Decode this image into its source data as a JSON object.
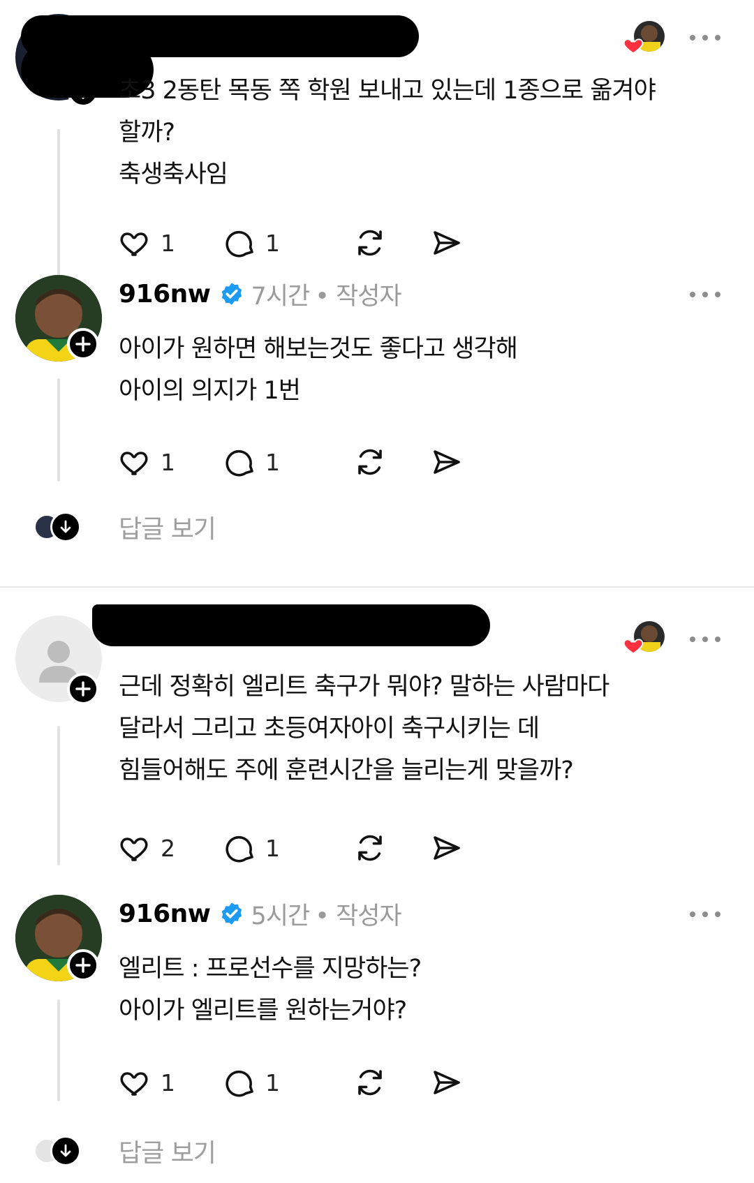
{
  "posts": [
    {
      "text": "초3 2동탄 목동 쪽 학원 보내고 있는데 1종으로 옮겨야\n할까?\n축생축사임",
      "likes": "1",
      "comments": "1"
    },
    {
      "username": "916nw",
      "time": "7시간",
      "author_tag": "• 작성자",
      "text": "아이가 원하면 해보는것도 좋다고 생각해\n아이의 의지가 1번",
      "likes": "1",
      "comments": "1"
    },
    {
      "text": "근데 정확히 엘리트 축구가 뭐야? 말하는 사람마다\n달라서 그리고 초등여자아이 축구시키는 데\n힘들어해도 주에 훈련시간을 늘리는게 맞을까?",
      "likes": "2",
      "comments": "1"
    },
    {
      "username": "916nw",
      "time": "5시간",
      "author_tag": "• 작성자",
      "text": "엘리트 : 프로선수를 지망하는?\n아이가 엘리트를 원하는거야?",
      "likes": "1",
      "comments": "1"
    }
  ],
  "view_replies_label": "답글 보기",
  "colors": {
    "verified_blue": "#1d9bf0",
    "heart_red": "#ff3040",
    "muted_text": "#9a9a9a"
  },
  "icons": [
    "heart-icon",
    "comment-icon",
    "repost-icon",
    "share-icon",
    "more-icon",
    "verified-icon",
    "plus-icon",
    "arrow-down-icon"
  ]
}
